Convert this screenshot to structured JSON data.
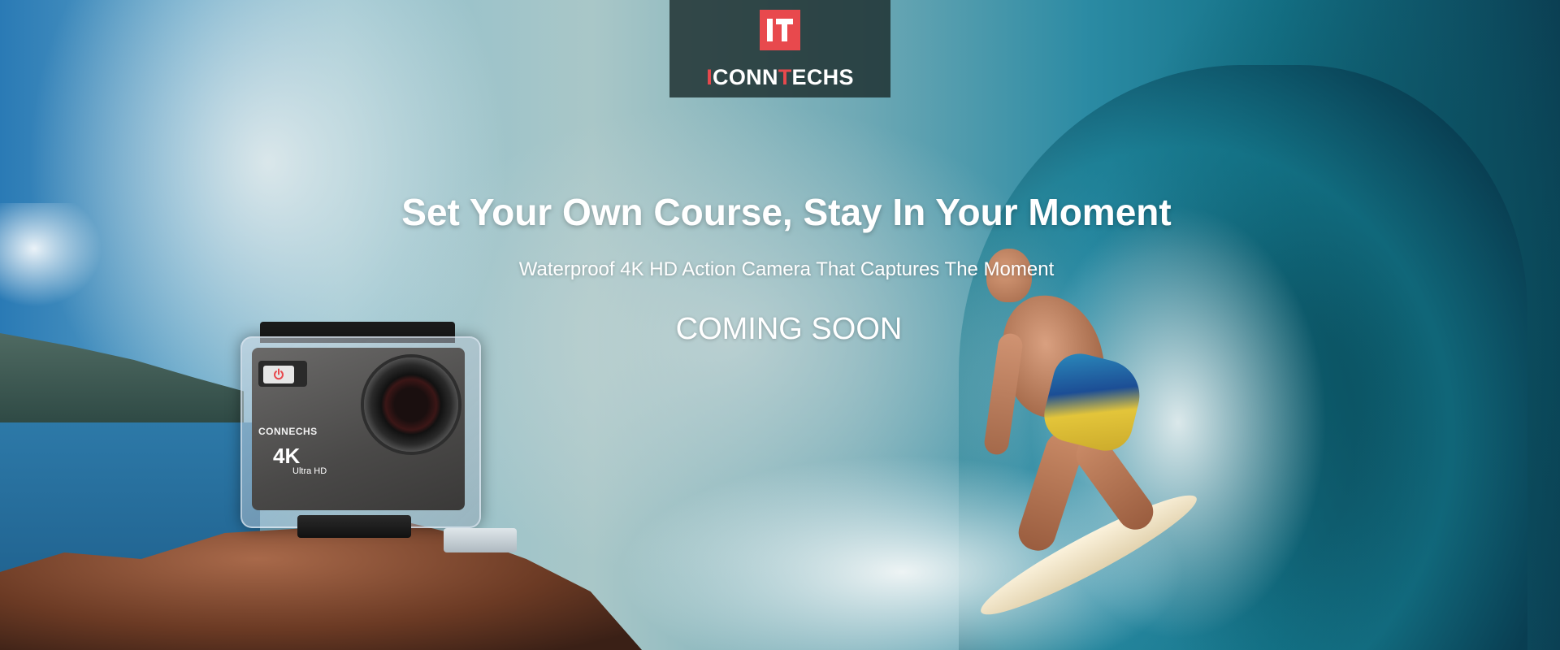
{
  "logo": {
    "mark_text": "IT",
    "brand_prefix": "I",
    "brand_middle_1": "CONN",
    "brand_accent": "T",
    "brand_middle_2": "ECHS",
    "brand_color": "#e8494d"
  },
  "hero": {
    "title": "Set Your Own Course, Stay In Your Moment",
    "subtitle": "Waterproof 4K HD Action Camera That Captures The Moment",
    "cta": "COMING SOON"
  },
  "product": {
    "brand_label": "CONNECHS",
    "resolution_label": "4K",
    "resolution_sub": "Ultra HD",
    "power_icon": "power-icon"
  },
  "colors": {
    "accent": "#e8494d",
    "text": "#ffffff",
    "logo_bg": "#1c2d2d"
  }
}
